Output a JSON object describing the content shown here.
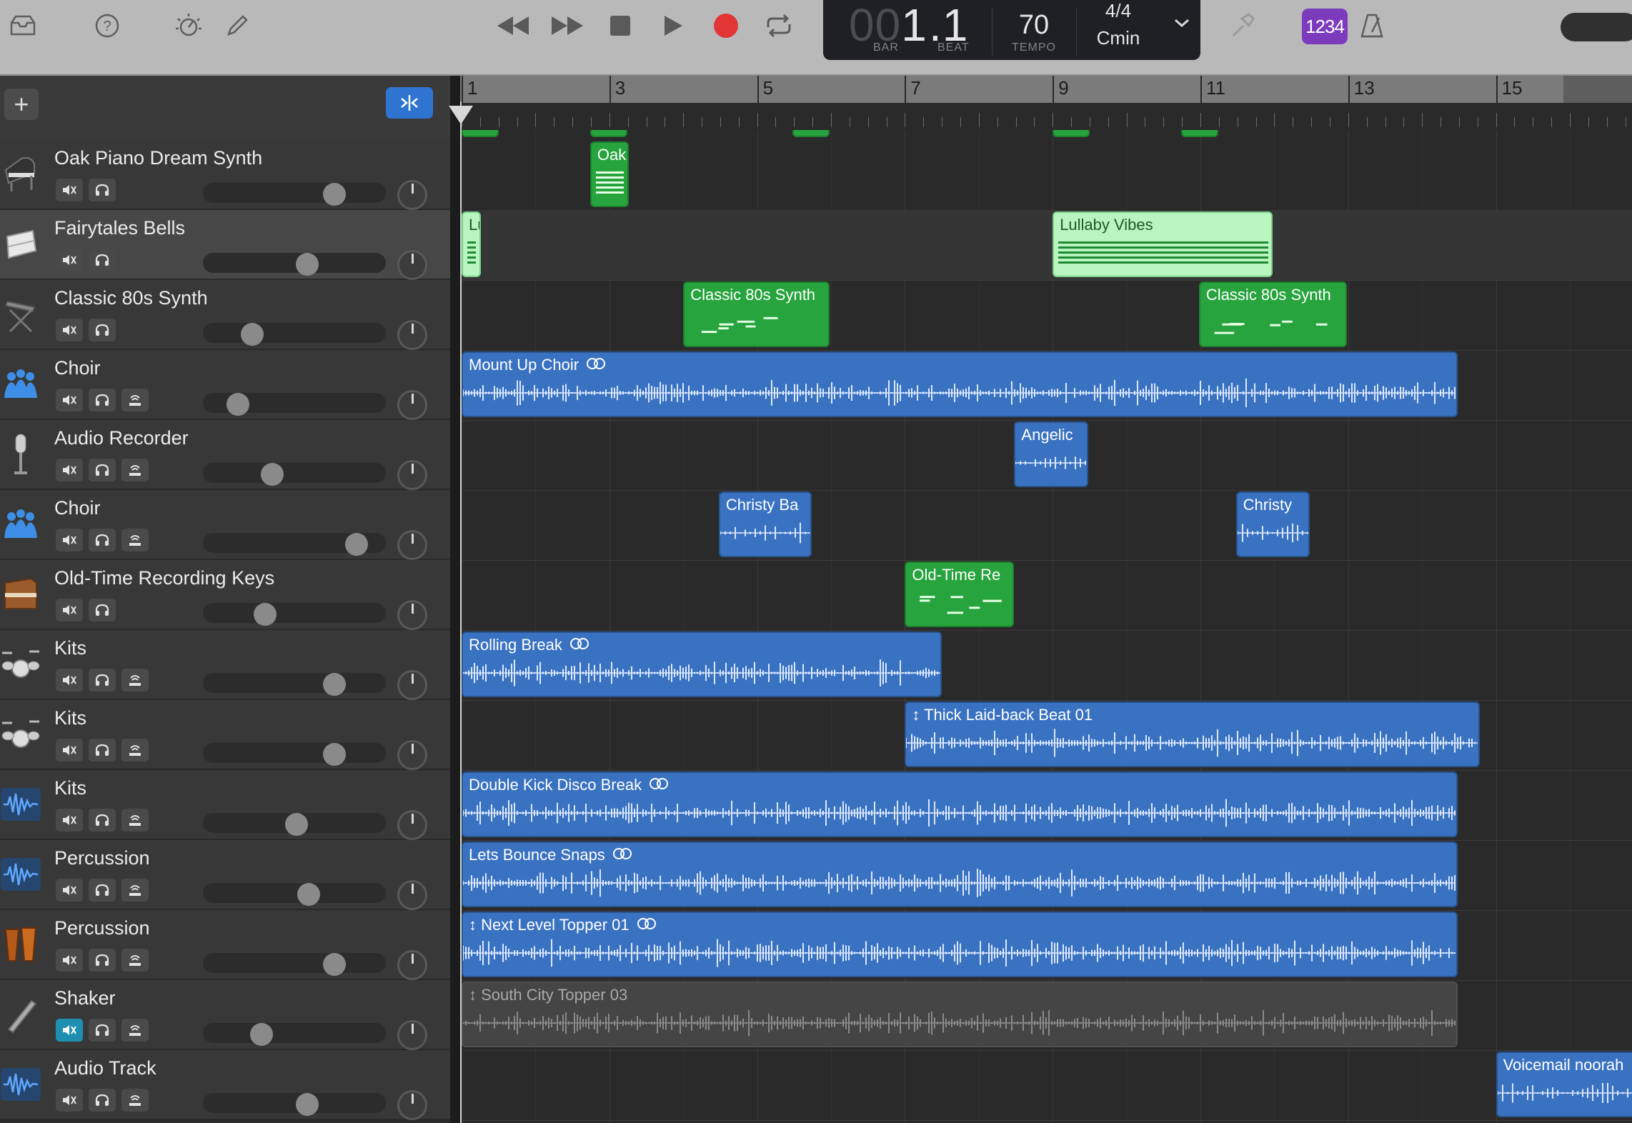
{
  "toolbar": {
    "icons": [
      "library-icon",
      "help-icon",
      "smart-controls-icon",
      "editor-icon"
    ],
    "transport": [
      "rewind-icon",
      "fast-forward-icon",
      "stop-icon",
      "play-icon",
      "record-icon",
      "cycle-icon"
    ],
    "lcd": {
      "bar_dim": "00",
      "bar": "1",
      "beat": ".1",
      "bar_label": "BAR",
      "beat_label": "BEAT",
      "tempo": "70",
      "tempo_label": "TEMPO",
      "time_signature": "4/4",
      "key": "Cmin"
    },
    "count_in": "1234",
    "colors": {
      "record": "#e23636",
      "count_in": "#7c3bbd"
    }
  },
  "header": {
    "add_label": "+"
  },
  "ruler": {
    "bar_numbers": [
      "1",
      "3",
      "5",
      "7",
      "9",
      "11",
      "13",
      "15"
    ]
  },
  "tracks": [
    {
      "name": "Oak Piano Dream Synth",
      "icon": "piano-icon",
      "controls": [
        "mute",
        "solo"
      ],
      "volume": 0.72,
      "selected": false,
      "muted": false
    },
    {
      "name": "Fairytales Bells",
      "icon": "keyboard-icon",
      "controls": [
        "mute",
        "solo"
      ],
      "volume": 0.57,
      "selected": true,
      "muted": false
    },
    {
      "name": "Classic 80s Synth",
      "icon": "synth-stand-icon",
      "controls": [
        "mute",
        "solo"
      ],
      "volume": 0.27,
      "selected": false,
      "muted": false
    },
    {
      "name": "Choir",
      "icon": "choir-icon",
      "controls": [
        "mute",
        "solo",
        "input"
      ],
      "volume": 0.19,
      "selected": false,
      "muted": false
    },
    {
      "name": "Audio Recorder",
      "icon": "microphone-icon",
      "controls": [
        "mute",
        "solo",
        "input"
      ],
      "volume": 0.38,
      "selected": false,
      "muted": false
    },
    {
      "name": "Choir",
      "icon": "choir-icon",
      "controls": [
        "mute",
        "solo",
        "input"
      ],
      "volume": 0.84,
      "selected": false,
      "muted": false
    },
    {
      "name": "Old-Time Recording Keys",
      "icon": "upright-piano-icon",
      "controls": [
        "mute",
        "solo"
      ],
      "volume": 0.34,
      "selected": false,
      "muted": false
    },
    {
      "name": "Kits",
      "icon": "drum-kit-icon",
      "controls": [
        "mute",
        "solo",
        "input"
      ],
      "volume": 0.72,
      "selected": false,
      "muted": false
    },
    {
      "name": "Kits",
      "icon": "drum-kit-icon",
      "controls": [
        "mute",
        "solo",
        "input"
      ],
      "volume": 0.72,
      "selected": false,
      "muted": false
    },
    {
      "name": "Kits",
      "icon": "audio-waveform-icon",
      "controls": [
        "mute",
        "solo",
        "input"
      ],
      "volume": 0.51,
      "selected": false,
      "muted": false
    },
    {
      "name": "Percussion",
      "icon": "audio-waveform-icon",
      "controls": [
        "mute",
        "solo",
        "input"
      ],
      "volume": 0.58,
      "selected": false,
      "muted": false
    },
    {
      "name": "Percussion",
      "icon": "conga-icon",
      "controls": [
        "mute",
        "solo",
        "input"
      ],
      "volume": 0.72,
      "selected": false,
      "muted": false
    },
    {
      "name": "Shaker",
      "icon": "shaker-icon",
      "controls": [
        "mute",
        "solo",
        "input"
      ],
      "volume": 0.32,
      "selected": false,
      "muted": true
    },
    {
      "name": "Audio Track",
      "icon": "audio-waveform-icon",
      "controls": [
        "mute",
        "solo",
        "input"
      ],
      "volume": 0.57,
      "selected": false,
      "muted": false
    }
  ],
  "regions": [
    {
      "track": 0,
      "name": "Oak P",
      "type": "midi",
      "color": "green",
      "start": 2.74,
      "end": 3.26,
      "loop": false
    },
    {
      "track": 1,
      "name": "Lull",
      "type": "midi",
      "color": "lightgreen",
      "start": 1.0,
      "end": 1.26,
      "loop": false
    },
    {
      "track": 1,
      "name": "Lullaby Vibes",
      "type": "midi",
      "color": "lightgreen",
      "start": 9.0,
      "end": 11.98,
      "loop": false
    },
    {
      "track": 2,
      "name": "Classic 80s Synth",
      "type": "midi",
      "color": "green",
      "start": 4.0,
      "end": 5.98,
      "loop": false
    },
    {
      "track": 2,
      "name": "Classic 80s Synth",
      "type": "midi",
      "color": "green",
      "start": 10.98,
      "end": 12.98,
      "loop": false
    },
    {
      "track": 3,
      "name": "Mount Up Choir",
      "type": "audio",
      "color": "blue",
      "start": 1.0,
      "end": 14.48,
      "loop": true
    },
    {
      "track": 4,
      "name": "Angelic",
      "type": "audio",
      "color": "blue",
      "start": 8.48,
      "end": 9.48,
      "loop": false
    },
    {
      "track": 5,
      "name": "Christy Ba",
      "type": "audio",
      "color": "blue",
      "start": 4.48,
      "end": 5.74,
      "loop": false
    },
    {
      "track": 5,
      "name": "Christy",
      "type": "audio",
      "color": "blue",
      "start": 11.48,
      "end": 12.48,
      "loop": false
    },
    {
      "track": 6,
      "name": "Old-Time Re",
      "type": "midi",
      "color": "green",
      "start": 7.0,
      "end": 8.48,
      "loop": false
    },
    {
      "track": 7,
      "name": "Rolling Break",
      "type": "audio",
      "color": "blue",
      "start": 1.0,
      "end": 7.5,
      "loop": true
    },
    {
      "track": 8,
      "name": "Thick Laid-back Beat 01",
      "type": "audio",
      "color": "blue",
      "start": 7.0,
      "end": 14.78,
      "loop": false,
      "drummer": true
    },
    {
      "track": 9,
      "name": "Double Kick Disco Break",
      "type": "audio",
      "color": "blue",
      "start": 1.0,
      "end": 14.48,
      "loop": true
    },
    {
      "track": 10,
      "name": "Lets Bounce Snaps",
      "type": "audio",
      "color": "blue",
      "start": 1.0,
      "end": 14.48,
      "loop": true
    },
    {
      "track": 11,
      "name": "Next Level Topper 01",
      "type": "audio",
      "color": "blue",
      "start": 1.0,
      "end": 14.48,
      "loop": true,
      "drummer": true
    },
    {
      "track": 12,
      "name": "South City Topper 03",
      "type": "audio",
      "color": "gray",
      "start": 1.0,
      "end": 14.48,
      "loop": false,
      "drummer": true
    },
    {
      "track": 13,
      "name": "Voicemail noorah",
      "type": "audio",
      "color": "blue",
      "start": 15.0,
      "end": 16.9,
      "loop": false
    }
  ],
  "partial_top_regions": [
    1.0,
    2.74,
    5.48,
    9.0,
    10.74
  ]
}
